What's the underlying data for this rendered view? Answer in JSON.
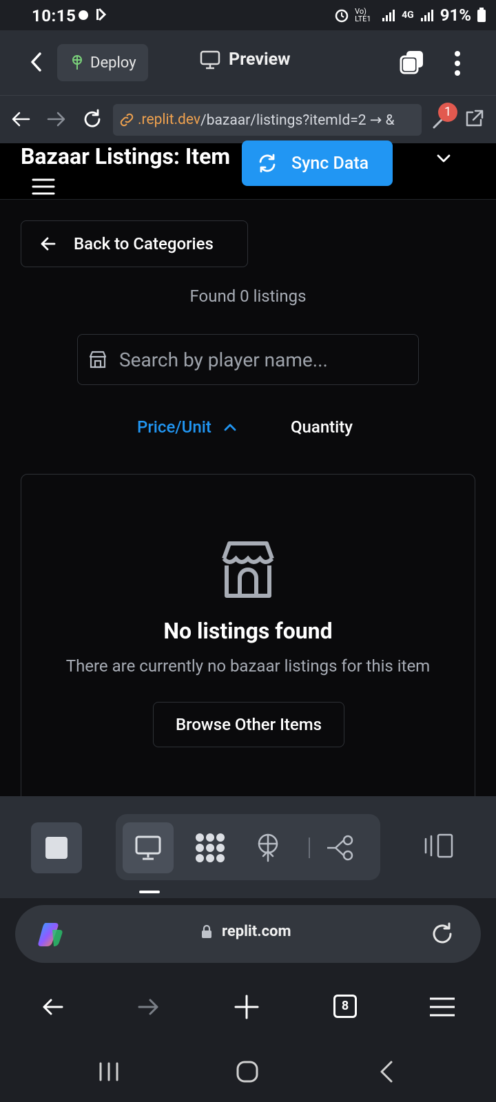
{
  "status": {
    "time": "10:15",
    "battery": "91%",
    "net": "4G",
    "volte": "Vo) LTE1"
  },
  "topbar": {
    "deploy_label": "Deploy",
    "preview_label": "Preview"
  },
  "urlbar": {
    "url_host": ".replit.dev",
    "url_path": "/bazaar/listings?itemId=2 → &",
    "badge_count": "1"
  },
  "app": {
    "title": "Bazaar Listings: Item",
    "sync_label": "Sync Data",
    "back_label": "Back to Categories",
    "found_text": "Found 0 listings",
    "search_placeholder": "Search by player name...",
    "sort_price": "Price/Unit",
    "sort_quantity": "Quantity",
    "empty_title": "No listings found",
    "empty_desc": "There are currently no bazaar listings for this item",
    "browse_label": "Browse Other Items"
  },
  "browser": {
    "omni_url": "replit.com",
    "tab_count": "8"
  },
  "colors": {
    "accent": "#2196f3",
    "url_host": "#f0a24f",
    "badge": "#e2594f"
  }
}
